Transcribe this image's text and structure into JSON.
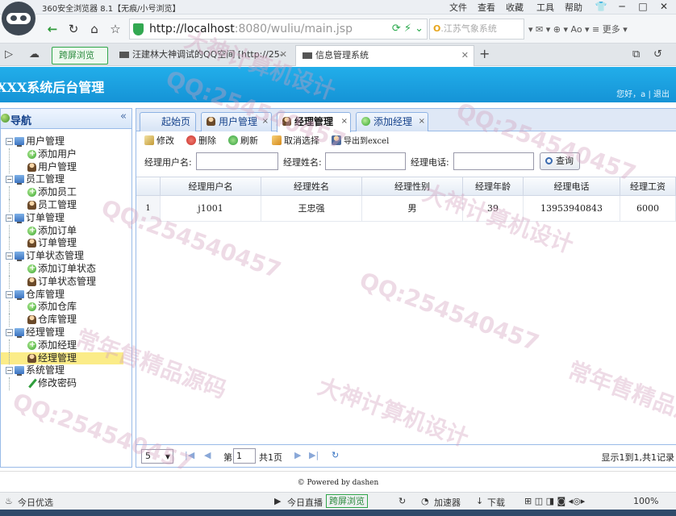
{
  "browser": {
    "window_title": "360安全浏览器 8.1【无痕/小号浏览】",
    "menu": [
      "文件",
      "查看",
      "收藏",
      "工具",
      "帮助"
    ],
    "url_host": "http://localhost",
    "url_rest": ":8080/wuliu/main.jsp",
    "search_text": "江苏气象系统",
    "extensions_more": "更多",
    "tabs": [
      {
        "label": "跨屏浏览"
      },
      {
        "label": "汪建林大神调试的QQ空间 [http://25-"
      },
      {
        "label": "信息管理系统"
      }
    ],
    "status": {
      "left": "今日优选",
      "live": "今日直播",
      "cross": "跨屏浏览",
      "accel": "加速器",
      "download": "下载",
      "zoom": "100%"
    }
  },
  "app": {
    "title": "XXX系统后台管理",
    "greeting": "您好，a",
    "logout": "退出"
  },
  "nav": {
    "title": "导航",
    "collapse": "«",
    "groups": [
      {
        "label": "用户管理",
        "items": [
          {
            "label": "添加用户",
            "icon": "add"
          },
          {
            "label": "用户管理",
            "icon": "user"
          }
        ]
      },
      {
        "label": "员工管理",
        "items": [
          {
            "label": "添加员工",
            "icon": "add"
          },
          {
            "label": "员工管理",
            "icon": "user"
          }
        ]
      },
      {
        "label": "订单管理",
        "items": [
          {
            "label": "添加订单",
            "icon": "add"
          },
          {
            "label": "订单管理",
            "icon": "user"
          }
        ]
      },
      {
        "label": "订单状态管理",
        "items": [
          {
            "label": "添加订单状态",
            "icon": "add"
          },
          {
            "label": "订单状态管理",
            "icon": "user"
          }
        ]
      },
      {
        "label": "仓库管理",
        "items": [
          {
            "label": "添加仓库",
            "icon": "add"
          },
          {
            "label": "仓库管理",
            "icon": "user"
          }
        ]
      },
      {
        "label": "经理管理",
        "items": [
          {
            "label": "添加经理",
            "icon": "add"
          },
          {
            "label": "经理管理",
            "icon": "user",
            "selected": true
          }
        ]
      },
      {
        "label": "系统管理",
        "items": [
          {
            "label": "修改密码",
            "icon": "pen"
          }
        ]
      }
    ]
  },
  "panel_tabs": [
    {
      "label": "起始页"
    },
    {
      "label": "用户管理"
    },
    {
      "label": "经理管理"
    },
    {
      "label": "添加经理"
    }
  ],
  "toolbar": {
    "edit": "修改",
    "delete": "删除",
    "refresh": "刷新",
    "unselect": "取消选择",
    "export": "导出到excel"
  },
  "filter": {
    "username_label": "经理用户名:",
    "name_label": "经理姓名:",
    "phone_label": "经理电话:",
    "search": "查询"
  },
  "grid": {
    "columns": [
      "经理用户名",
      "经理姓名",
      "经理性别",
      "经理年龄",
      "经理电话",
      "经理工资"
    ],
    "rows": [
      {
        "num": "1",
        "cells": [
          "j1001",
          "王忠强",
          "男",
          "39",
          "13953940843",
          "6000"
        ]
      }
    ]
  },
  "pager": {
    "page_size": "5",
    "page_prefix": "第",
    "page_value": "1",
    "page_suffix": "共1页",
    "info": "显示1到1,共1记录"
  },
  "footer": "© Powered by dashen",
  "watermarks": [
    "QQ:254540457",
    "大神计算机设计",
    "常年售精品源码"
  ]
}
